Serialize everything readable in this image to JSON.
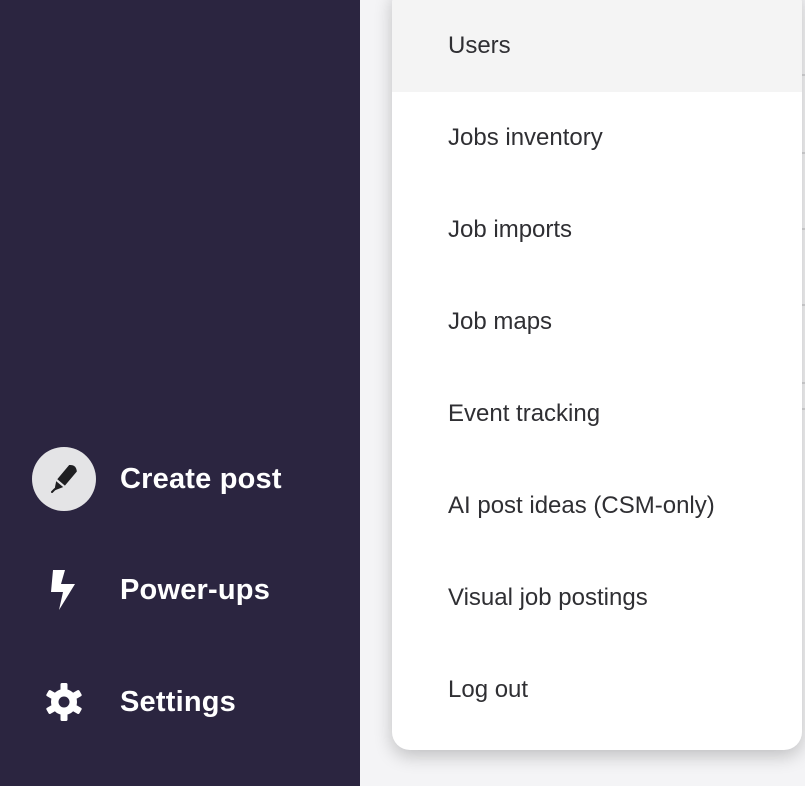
{
  "sidebar": {
    "background": "#2b2540",
    "items": [
      {
        "label": "Create post",
        "icon": "pen-icon"
      },
      {
        "label": "Power-ups",
        "icon": "lightning-icon"
      },
      {
        "label": "Settings",
        "icon": "gear-icon"
      }
    ]
  },
  "menu": {
    "items": [
      {
        "label": "Users",
        "hovered": true
      },
      {
        "label": "Jobs inventory"
      },
      {
        "label": "Job imports"
      },
      {
        "label": "Job maps"
      },
      {
        "label": "Event tracking"
      },
      {
        "label": "AI post ideas (CSM-only)"
      },
      {
        "label": "Visual job postings"
      },
      {
        "label": "Log out"
      }
    ]
  }
}
